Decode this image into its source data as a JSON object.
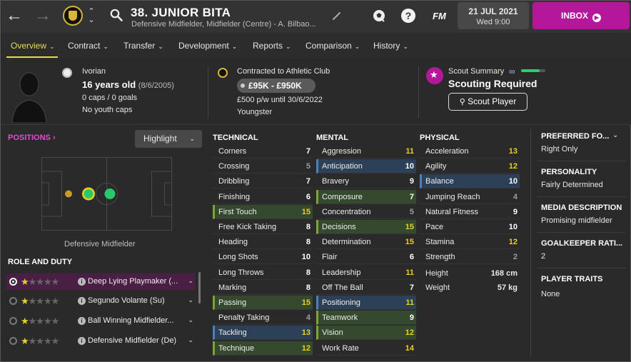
{
  "header": {
    "title": "38. JUNIOR BITA",
    "subtitle": "Defensive Midfielder, Midfielder (Centre) - A. Bilbao...",
    "fm_label": "FM",
    "date": "21 JUL 2021",
    "time": "Wed 9:00",
    "inbox_label": "INBOX",
    "help_label": "?"
  },
  "tabs": [
    {
      "label": "Overview"
    },
    {
      "label": "Contract"
    },
    {
      "label": "Transfer"
    },
    {
      "label": "Development"
    },
    {
      "label": "Reports"
    },
    {
      "label": "Comparison"
    },
    {
      "label": "History"
    }
  ],
  "info": {
    "nationality": "Ivorian",
    "age": "16 years old",
    "dob": "(8/6/2005)",
    "caps": "0 caps / 0 goals",
    "youth_caps": "No youth caps",
    "contract": "Contracted to Athletic Club",
    "value": "£95K - £950K",
    "wage": "£500 p/w until 30/6/2022",
    "status": "Youngster",
    "scout_summary": "Scout Summary",
    "scouting": "Scouting Required",
    "scout_button": "Scout Player",
    "knowledge_level": 0.75
  },
  "positions": {
    "title": "POSITIONS",
    "highlight_label": "Highlight",
    "pitch_label": "Defensive Midfielder"
  },
  "roles": {
    "title": "ROLE AND DUTY",
    "items": [
      {
        "name": "Deep Lying Playmaker (...",
        "stars": 1,
        "selected": true
      },
      {
        "name": "Segundo Volante (Su)",
        "stars": 1,
        "selected": false
      },
      {
        "name": "Ball Winning Midfielder...",
        "stars": 1,
        "selected": false
      },
      {
        "name": "Defensive Midfielder (De)",
        "stars": 1,
        "selected": false
      }
    ]
  },
  "attributes": {
    "technical_title": "TECHNICAL",
    "mental_title": "MENTAL",
    "physical_title": "PHYSICAL",
    "technical": [
      {
        "name": "Corners",
        "value": "7",
        "hl": "",
        "vc": "w"
      },
      {
        "name": "Crossing",
        "value": "5",
        "hl": "",
        "vc": "g"
      },
      {
        "name": "Dribbling",
        "value": "7",
        "hl": "",
        "vc": "w"
      },
      {
        "name": "Finishing",
        "value": "6",
        "hl": "",
        "vc": "w"
      },
      {
        "name": "First Touch",
        "value": "15",
        "hl": "g",
        "vc": "y"
      },
      {
        "name": "Free Kick Taking",
        "value": "8",
        "hl": "",
        "vc": "w"
      },
      {
        "name": "Heading",
        "value": "8",
        "hl": "",
        "vc": "w"
      },
      {
        "name": "Long Shots",
        "value": "10",
        "hl": "",
        "vc": "w"
      },
      {
        "name": "Long Throws",
        "value": "8",
        "hl": "",
        "vc": "w"
      },
      {
        "name": "Marking",
        "value": "8",
        "hl": "",
        "vc": "w"
      },
      {
        "name": "Passing",
        "value": "15",
        "hl": "g",
        "vc": "y"
      },
      {
        "name": "Penalty Taking",
        "value": "4",
        "hl": "",
        "vc": "g"
      },
      {
        "name": "Tackling",
        "value": "13",
        "hl": "b",
        "vc": "y"
      },
      {
        "name": "Technique",
        "value": "12",
        "hl": "g",
        "vc": "y"
      }
    ],
    "mental": [
      {
        "name": "Aggression",
        "value": "11",
        "hl": "",
        "vc": "y"
      },
      {
        "name": "Anticipation",
        "value": "10",
        "hl": "b",
        "vc": "w"
      },
      {
        "name": "Bravery",
        "value": "9",
        "hl": "",
        "vc": "w"
      },
      {
        "name": "Composure",
        "value": "7",
        "hl": "g",
        "vc": "w"
      },
      {
        "name": "Concentration",
        "value": "5",
        "hl": "",
        "vc": "g"
      },
      {
        "name": "Decisions",
        "value": "15",
        "hl": "g",
        "vc": "y"
      },
      {
        "name": "Determination",
        "value": "15",
        "hl": "",
        "vc": "y"
      },
      {
        "name": "Flair",
        "value": "6",
        "hl": "",
        "vc": "w"
      },
      {
        "name": "Leadership",
        "value": "11",
        "hl": "",
        "vc": "y"
      },
      {
        "name": "Off The Ball",
        "value": "7",
        "hl": "",
        "vc": "w"
      },
      {
        "name": "Positioning",
        "value": "11",
        "hl": "b",
        "vc": "y"
      },
      {
        "name": "Teamwork",
        "value": "9",
        "hl": "g",
        "vc": "w"
      },
      {
        "name": "Vision",
        "value": "12",
        "hl": "g",
        "vc": "y"
      },
      {
        "name": "Work Rate",
        "value": "14",
        "hl": "",
        "vc": "y"
      }
    ],
    "physical": [
      {
        "name": "Acceleration",
        "value": "13",
        "hl": "",
        "vc": "y"
      },
      {
        "name": "Agility",
        "value": "12",
        "hl": "",
        "vc": "y"
      },
      {
        "name": "Balance",
        "value": "10",
        "hl": "b",
        "vc": "w"
      },
      {
        "name": "Jumping Reach",
        "value": "4",
        "hl": "",
        "vc": "g"
      },
      {
        "name": "Natural Fitness",
        "value": "9",
        "hl": "",
        "vc": "w"
      },
      {
        "name": "Pace",
        "value": "10",
        "hl": "",
        "vc": "w"
      },
      {
        "name": "Stamina",
        "value": "12",
        "hl": "",
        "vc": "y"
      },
      {
        "name": "Strength",
        "value": "2",
        "hl": "",
        "vc": "g"
      }
    ],
    "height_label": "Height",
    "height": "168 cm",
    "weight_label": "Weight",
    "weight": "57 kg"
  },
  "right_panel": {
    "preferred_foot_title": "PREFERRED FO...",
    "preferred_foot": "Right Only",
    "personality_title": "PERSONALITY",
    "personality": "Fairly Determined",
    "media_title": "MEDIA DESCRIPTION",
    "media": "Promising midfielder",
    "gk_title": "GOALKEEPER RATI...",
    "gk": "2",
    "traits_title": "PLAYER TRAITS",
    "traits": "None"
  },
  "colors": {
    "accent": "#b5179b",
    "tab_active": "#e4dd4b",
    "good_value": "#e9d020",
    "key_green": "#34492e",
    "key_blue": "#2c4157"
  },
  "icons": [
    "back-arrow-icon",
    "forward-arrow-icon",
    "club-crest-icon",
    "chevron-up-icon",
    "chevron-down-icon",
    "search-icon",
    "pencil-icon",
    "football-icon",
    "help-icon",
    "play-circle-icon",
    "flag-icon",
    "star-icon",
    "info-icon",
    "infinity-icon"
  ]
}
